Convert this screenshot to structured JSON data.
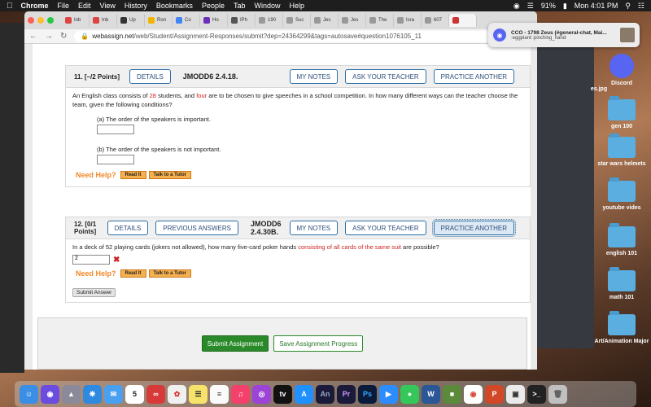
{
  "menubar": {
    "apple": "",
    "items": [
      "Chrome",
      "File",
      "Edit",
      "View",
      "History",
      "Bookmarks",
      "People",
      "Tab",
      "Window",
      "Help"
    ],
    "battery": "91%",
    "clock": "Mon 4:01 PM"
  },
  "chrome": {
    "tabs": [
      "Inb",
      "Inb",
      "Up",
      "Ron",
      "Co",
      "Ho",
      "IPh",
      "190",
      "Suc",
      "Jes",
      "Jes",
      "The",
      "Isra",
      "607"
    ],
    "url_host": "webassign.net",
    "url_path": "/web/Student/Assignment-Responses/submit?dep=24364299&tags=autosave#question1076105_11"
  },
  "question11": {
    "number": "11.",
    "points": "[–/2 Points]",
    "details": "DETAILS",
    "code": "JMODD6 2.4.18.",
    "my_notes": "MY NOTES",
    "ask_teacher": "ASK YOUR TEACHER",
    "practice": "PRACTICE ANOTHER",
    "text_a": "An English class consists of ",
    "text_n1": "28",
    "text_b": " students, and ",
    "text_n2": "four",
    "text_c": " are to be chosen to give speeches in a school competition. In how many different ways can the teacher choose the team, given the following conditions?",
    "part_a": "(a) The order of the speakers is important.",
    "part_b": "(b) The order of the speakers is not important.",
    "need_help": "Need Help?",
    "read_it": "Read It",
    "talk_tutor": "Talk to a Tutor"
  },
  "question12": {
    "number": "12.",
    "points": "[0/1 Points]",
    "details": "DETAILS",
    "previous": "PREVIOUS ANSWERS",
    "code": "JMODD6 2.4.30B.",
    "my_notes": "MY NOTES",
    "ask_teacher": "ASK YOUR TEACHER",
    "practice": "PRACTICE ANOTHER",
    "text_a": "In a deck of 52 playing cards (jokers not allowed), how many five-card poker hands ",
    "text_red": "consisting of all cards of the same suit",
    "text_b": " are possible?",
    "answer": "2",
    "need_help": "Need Help?",
    "read_it": "Read It",
    "talk_tutor": "Talk to a Tutor",
    "submit_answer": "Submit Answer"
  },
  "footer": {
    "submit_assignment": "Submit Assignment",
    "save_progress": "Save Assignment Progress"
  },
  "notification": {
    "title": "CCO - 1798 Zeus (#general-chat, Mai...",
    "body": ":eggplant::pinching_hand:"
  },
  "desktop": {
    "items": [
      "Discord",
      "gen 100",
      "star wars helmets",
      "youtube vides",
      "english 101",
      "math 101",
      "Art/Animation Major"
    ],
    "jpg_label": "es.jpg"
  },
  "dock": {
    "apps": [
      "finder",
      "siri",
      "launchpad",
      "safari",
      "mail",
      "calendar",
      "cc",
      "photos",
      "notes",
      "reminders",
      "music",
      "podcasts",
      "tv",
      "appstore",
      "An",
      "Pr",
      "Ps",
      "zoom",
      "messages",
      "word",
      "minecraft",
      "chrome",
      "powerpoint",
      "preview",
      "terminal",
      "trash"
    ],
    "calendar_day": "5"
  },
  "colors": {
    "webassign_blue": "#2d6fa7",
    "red_highlight": "#cc2222",
    "green_submit": "#2a8a2a",
    "help_orange": "#f0892a"
  }
}
